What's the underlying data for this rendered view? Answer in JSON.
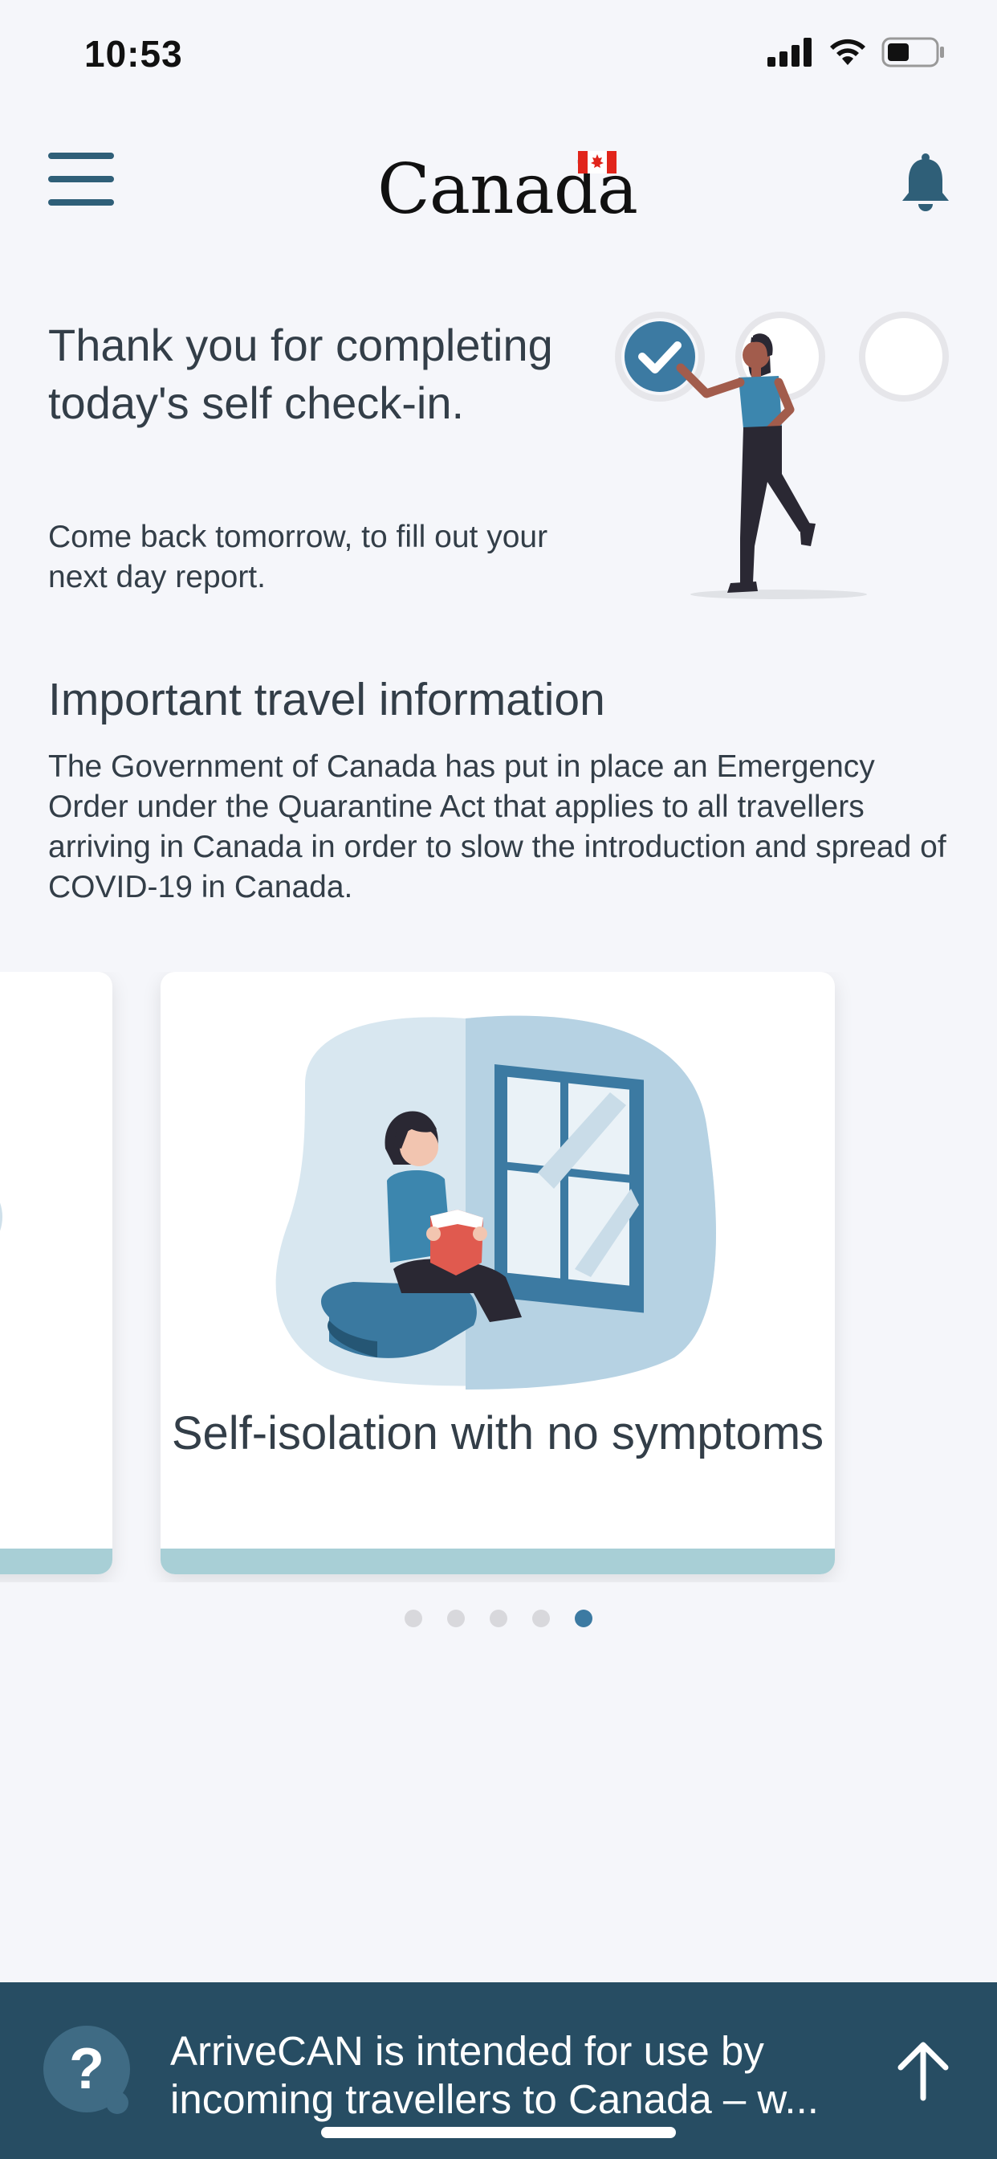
{
  "status_bar": {
    "time": "10:53",
    "signal_icon": "signal-bars-icon",
    "wifi_icon": "wifi-icon",
    "battery_icon": "battery-icon"
  },
  "header": {
    "menu_icon": "hamburger-menu-icon",
    "wordmark": "Canada",
    "notification_icon": "bell-icon"
  },
  "hero": {
    "title": "Thank you for completing today's self check-in.",
    "subtitle": "Come back tomorrow, to fill out your next day report.",
    "progress_completed": 1,
    "progress_total": 3
  },
  "info": {
    "title": "Important travel information",
    "body": "The Government of Canada has put in place an Emergency Order under the Quarantine Act that applies to all travellers arriving in Canada in order to slow the introduction and spread of COVID-19 in Canada."
  },
  "carousel": {
    "cards": [
      {
        "title": ""
      },
      {
        "title": "Self-isolation with no symptoms"
      }
    ],
    "page_count": 5,
    "active_page": 5
  },
  "footer": {
    "help_icon": "help-question-icon",
    "message": "ArriveCAN is intended for use by incoming travellers to Canada – w...",
    "up_icon": "arrow-up-icon"
  },
  "colors": {
    "accent": "#3c7aa2",
    "footer_bg": "#274d63",
    "card_stripe": "#a8cfd6",
    "background": "#f5f6fa"
  }
}
